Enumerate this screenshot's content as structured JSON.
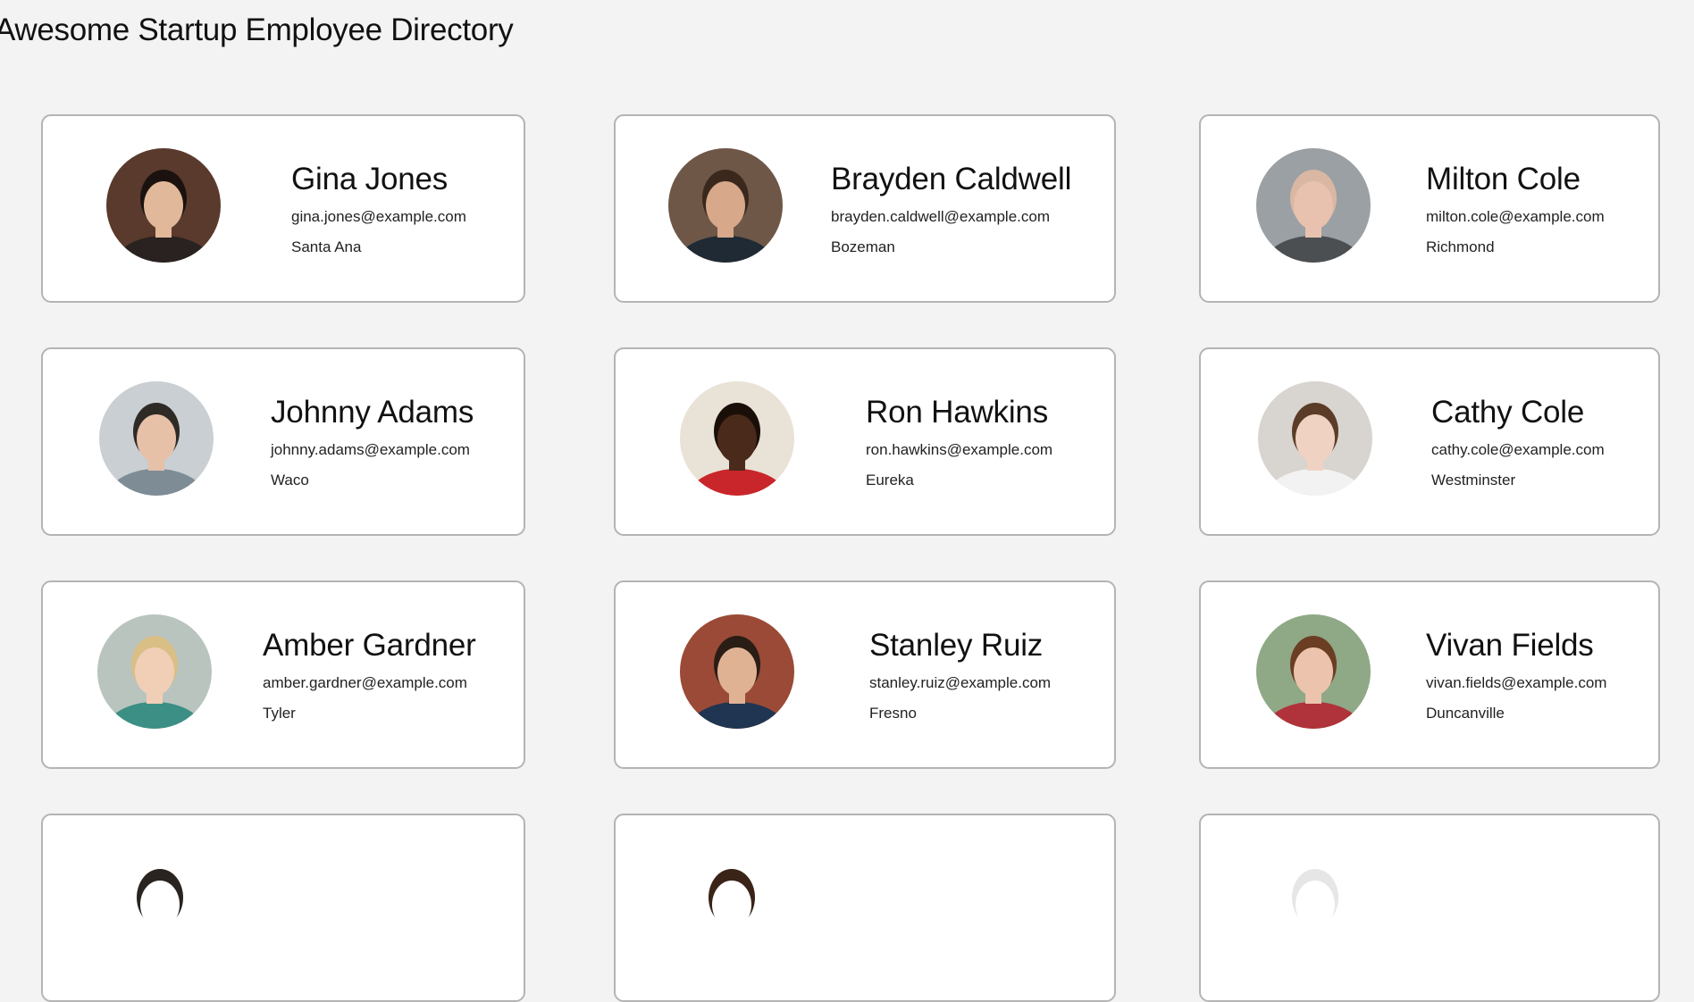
{
  "page": {
    "title": "Awesome Startup Employee Directory"
  },
  "employees": [
    {
      "name": "Gina Jones",
      "email": "gina.jones@example.com",
      "location": "Santa Ana",
      "photo": {
        "bg": "#5a3a2c",
        "skin": "#e2b89a",
        "hair": "#1b1210",
        "shirt": "#2a2220"
      }
    },
    {
      "name": "Brayden Caldwell",
      "email": "brayden.caldwell@example.com",
      "location": "Bozeman",
      "photo": {
        "bg": "#6e5747",
        "skin": "#d7a88a",
        "hair": "#3a281c",
        "shirt": "#1f2a35"
      }
    },
    {
      "name": "Milton Cole",
      "email": "milton.cole@example.com",
      "location": "Richmond",
      "photo": {
        "bg": "#9aa0a4",
        "skin": "#e8c2ae",
        "hair": "#d9b7a3",
        "shirt": "#4b4f52"
      }
    },
    {
      "name": "Johnny Adams",
      "email": "johnny.adams@example.com",
      "location": "Waco",
      "photo": {
        "bg": "#c9cfd2",
        "skin": "#e6c1a8",
        "hair": "#2e2a26",
        "shirt": "#7e8c96"
      }
    },
    {
      "name": "Ron Hawkins",
      "email": "ron.hawkins@example.com",
      "location": "Eureka",
      "photo": {
        "bg": "#e9e2d6",
        "skin": "#4a2a1a",
        "hair": "#1a0e08",
        "shirt": "#c8262a"
      }
    },
    {
      "name": "Cathy Cole",
      "email": "cathy.cole@example.com",
      "location": "Westminster",
      "photo": {
        "bg": "#d8d4d0",
        "skin": "#f0d2c2",
        "hair": "#5b3c28",
        "shirt": "#f2f2f2"
      }
    },
    {
      "name": "Amber Gardner",
      "email": "amber.gardner@example.com",
      "location": "Tyler",
      "photo": {
        "bg": "#b9c4bf",
        "skin": "#f0cfb6",
        "hair": "#d9bf86",
        "shirt": "#3b8f84"
      }
    },
    {
      "name": "Stanley Ruiz",
      "email": "stanley.ruiz@example.com",
      "location": "Fresno",
      "photo": {
        "bg": "#9a4a36",
        "skin": "#e0b294",
        "hair": "#2a1d16",
        "shirt": "#1f3552"
      }
    },
    {
      "name": "Vivan Fields",
      "email": "vivan.fields@example.com",
      "location": "Duncanville",
      "photo": {
        "bg": "#8fa886",
        "skin": "#ecc3ad",
        "hair": "#6b3e24",
        "shirt": "#b0323a"
      }
    }
  ],
  "partial_photos": [
    {
      "bg": "#ffffff",
      "skin": "#ffffff",
      "hair": "#2a2420",
      "shirt": "#ffffff"
    },
    {
      "bg": "#ffffff",
      "skin": "#ffffff",
      "hair": "#3a2418",
      "shirt": "#ffffff"
    },
    {
      "bg": "#ffffff",
      "skin": "#ffffff",
      "hair": "#e6e6e6",
      "shirt": "#ffffff"
    }
  ]
}
